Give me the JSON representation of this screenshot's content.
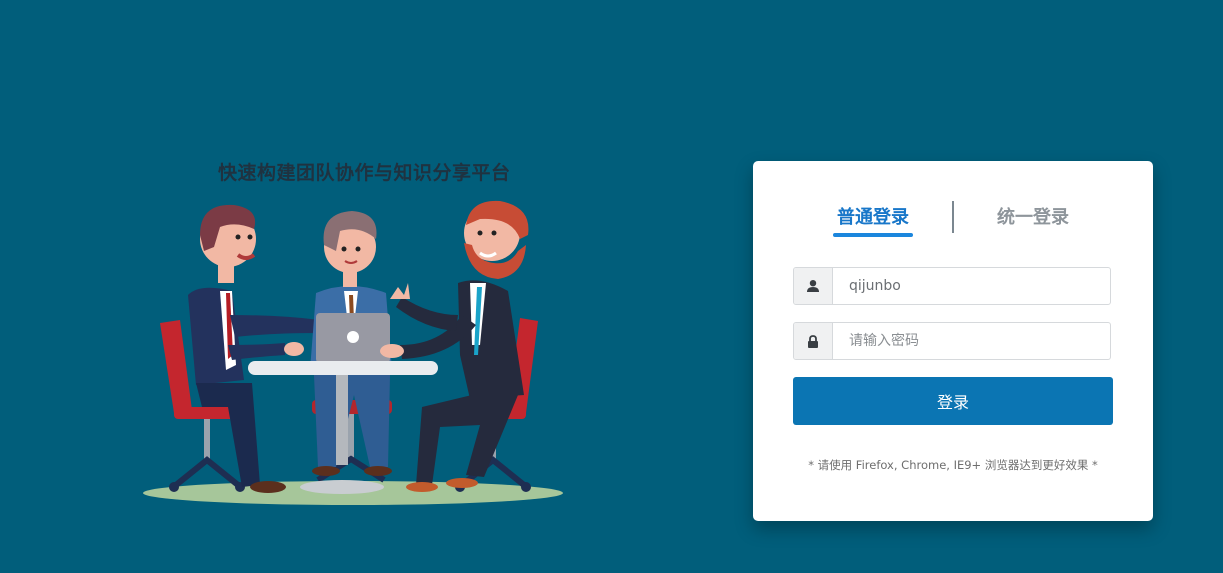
{
  "slogan": "快速构建团队协作与知识分享平台",
  "login": {
    "tabs": [
      {
        "label": "普通登录",
        "active": true
      },
      {
        "label": "统一登录",
        "active": false
      }
    ],
    "username": {
      "value": "qijunbo",
      "icon": "user-icon"
    },
    "password": {
      "value": "",
      "placeholder": "请输入密码",
      "icon": "lock-icon"
    },
    "submit_label": "登录",
    "browser_tip": "* 请使用 Firefox, Chrome, IE9+ 浏览器达到更好效果 *"
  },
  "colors": {
    "page_background": "#015e7b",
    "accent": "#1877c9",
    "button": "#0b75b3",
    "inactive_tab": "#8e959b"
  }
}
